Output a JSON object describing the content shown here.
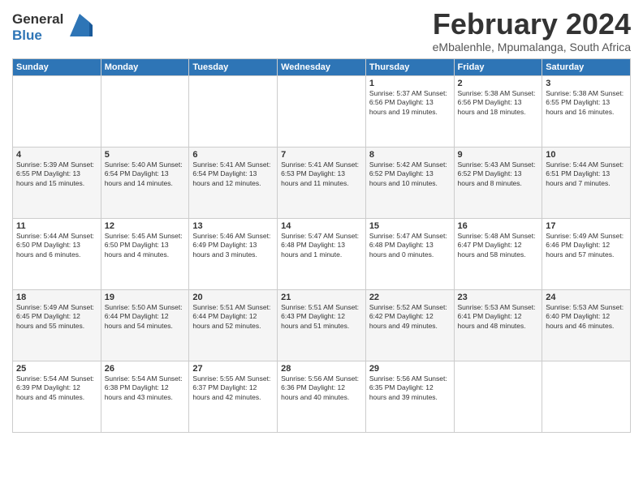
{
  "logo": {
    "line1": "General",
    "line2": "Blue"
  },
  "header": {
    "month_year": "February 2024",
    "location": "eMbalenhle, Mpumalanga, South Africa"
  },
  "weekdays": [
    "Sunday",
    "Monday",
    "Tuesday",
    "Wednesday",
    "Thursday",
    "Friday",
    "Saturday"
  ],
  "weeks": [
    [
      {
        "day": "",
        "info": ""
      },
      {
        "day": "",
        "info": ""
      },
      {
        "day": "",
        "info": ""
      },
      {
        "day": "",
        "info": ""
      },
      {
        "day": "1",
        "info": "Sunrise: 5:37 AM\nSunset: 6:56 PM\nDaylight: 13 hours\nand 19 minutes."
      },
      {
        "day": "2",
        "info": "Sunrise: 5:38 AM\nSunset: 6:56 PM\nDaylight: 13 hours\nand 18 minutes."
      },
      {
        "day": "3",
        "info": "Sunrise: 5:38 AM\nSunset: 6:55 PM\nDaylight: 13 hours\nand 16 minutes."
      }
    ],
    [
      {
        "day": "4",
        "info": "Sunrise: 5:39 AM\nSunset: 6:55 PM\nDaylight: 13 hours\nand 15 minutes."
      },
      {
        "day": "5",
        "info": "Sunrise: 5:40 AM\nSunset: 6:54 PM\nDaylight: 13 hours\nand 14 minutes."
      },
      {
        "day": "6",
        "info": "Sunrise: 5:41 AM\nSunset: 6:54 PM\nDaylight: 13 hours\nand 12 minutes."
      },
      {
        "day": "7",
        "info": "Sunrise: 5:41 AM\nSunset: 6:53 PM\nDaylight: 13 hours\nand 11 minutes."
      },
      {
        "day": "8",
        "info": "Sunrise: 5:42 AM\nSunset: 6:52 PM\nDaylight: 13 hours\nand 10 minutes."
      },
      {
        "day": "9",
        "info": "Sunrise: 5:43 AM\nSunset: 6:52 PM\nDaylight: 13 hours\nand 8 minutes."
      },
      {
        "day": "10",
        "info": "Sunrise: 5:44 AM\nSunset: 6:51 PM\nDaylight: 13 hours\nand 7 minutes."
      }
    ],
    [
      {
        "day": "11",
        "info": "Sunrise: 5:44 AM\nSunset: 6:50 PM\nDaylight: 13 hours\nand 6 minutes."
      },
      {
        "day": "12",
        "info": "Sunrise: 5:45 AM\nSunset: 6:50 PM\nDaylight: 13 hours\nand 4 minutes."
      },
      {
        "day": "13",
        "info": "Sunrise: 5:46 AM\nSunset: 6:49 PM\nDaylight: 13 hours\nand 3 minutes."
      },
      {
        "day": "14",
        "info": "Sunrise: 5:47 AM\nSunset: 6:48 PM\nDaylight: 13 hours\nand 1 minute."
      },
      {
        "day": "15",
        "info": "Sunrise: 5:47 AM\nSunset: 6:48 PM\nDaylight: 13 hours\nand 0 minutes."
      },
      {
        "day": "16",
        "info": "Sunrise: 5:48 AM\nSunset: 6:47 PM\nDaylight: 12 hours\nand 58 minutes."
      },
      {
        "day": "17",
        "info": "Sunrise: 5:49 AM\nSunset: 6:46 PM\nDaylight: 12 hours\nand 57 minutes."
      }
    ],
    [
      {
        "day": "18",
        "info": "Sunrise: 5:49 AM\nSunset: 6:45 PM\nDaylight: 12 hours\nand 55 minutes."
      },
      {
        "day": "19",
        "info": "Sunrise: 5:50 AM\nSunset: 6:44 PM\nDaylight: 12 hours\nand 54 minutes."
      },
      {
        "day": "20",
        "info": "Sunrise: 5:51 AM\nSunset: 6:44 PM\nDaylight: 12 hours\nand 52 minutes."
      },
      {
        "day": "21",
        "info": "Sunrise: 5:51 AM\nSunset: 6:43 PM\nDaylight: 12 hours\nand 51 minutes."
      },
      {
        "day": "22",
        "info": "Sunrise: 5:52 AM\nSunset: 6:42 PM\nDaylight: 12 hours\nand 49 minutes."
      },
      {
        "day": "23",
        "info": "Sunrise: 5:53 AM\nSunset: 6:41 PM\nDaylight: 12 hours\nand 48 minutes."
      },
      {
        "day": "24",
        "info": "Sunrise: 5:53 AM\nSunset: 6:40 PM\nDaylight: 12 hours\nand 46 minutes."
      }
    ],
    [
      {
        "day": "25",
        "info": "Sunrise: 5:54 AM\nSunset: 6:39 PM\nDaylight: 12 hours\nand 45 minutes."
      },
      {
        "day": "26",
        "info": "Sunrise: 5:54 AM\nSunset: 6:38 PM\nDaylight: 12 hours\nand 43 minutes."
      },
      {
        "day": "27",
        "info": "Sunrise: 5:55 AM\nSunset: 6:37 PM\nDaylight: 12 hours\nand 42 minutes."
      },
      {
        "day": "28",
        "info": "Sunrise: 5:56 AM\nSunset: 6:36 PM\nDaylight: 12 hours\nand 40 minutes."
      },
      {
        "day": "29",
        "info": "Sunrise: 5:56 AM\nSunset: 6:35 PM\nDaylight: 12 hours\nand 39 minutes."
      },
      {
        "day": "",
        "info": ""
      },
      {
        "day": "",
        "info": ""
      }
    ]
  ]
}
